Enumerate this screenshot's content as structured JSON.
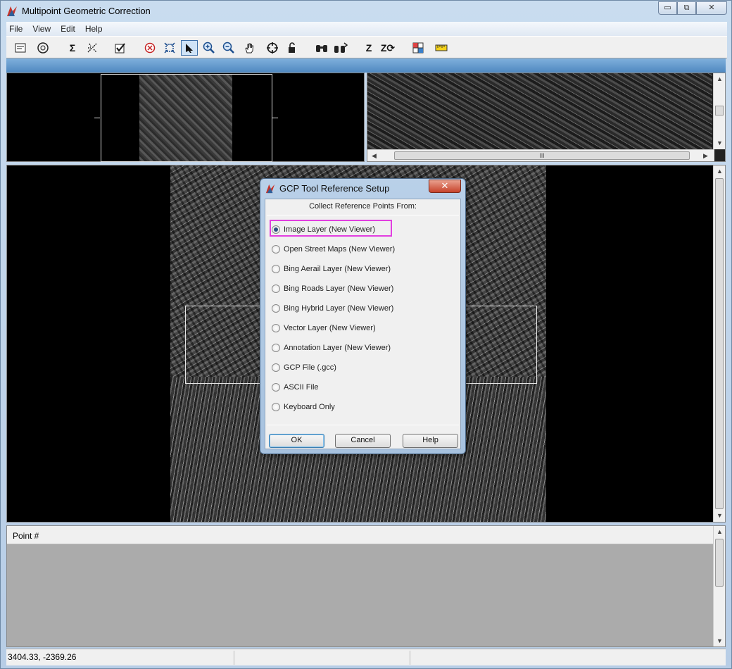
{
  "window": {
    "title": "Multipoint Geometric Correction",
    "controls": {
      "minimize": "▭",
      "restore": "⧉",
      "close": "✕"
    }
  },
  "menu": [
    "File",
    "View",
    "Edit",
    "Help"
  ],
  "toolbar": {
    "sigma": "Σ",
    "z_label": "Z",
    "z_arrow": "Z⟳"
  },
  "magnifier": {
    "scroll_grip": "III"
  },
  "table": {
    "column_point": "Point #"
  },
  "status": {
    "coordinates": "3404.33, -2369.26"
  },
  "dialog": {
    "title": "GCP Tool Reference Setup",
    "close_label": "✕",
    "heading": "Collect Reference Points From:",
    "options": [
      "Image Layer (New Viewer)",
      "Open Street Maps (New Viewer)",
      "Bing Aerail Layer (New Viewer)",
      "Bing Roads Layer (New Viewer)",
      "Bing Hybrid Layer (New Viewer)",
      "Vector Layer (New Viewer)",
      "Annotation Layer (New Viewer)",
      "GCP File (.gcc)",
      "ASCII File",
      "Keyboard Only"
    ],
    "selected_option": "Image Layer (New Viewer)",
    "buttons": {
      "ok": "OK",
      "cancel": "Cancel",
      "help": "Help"
    }
  },
  "colors": {
    "highlight": "#e23fe0",
    "accent_blue": "#4f88c0"
  }
}
